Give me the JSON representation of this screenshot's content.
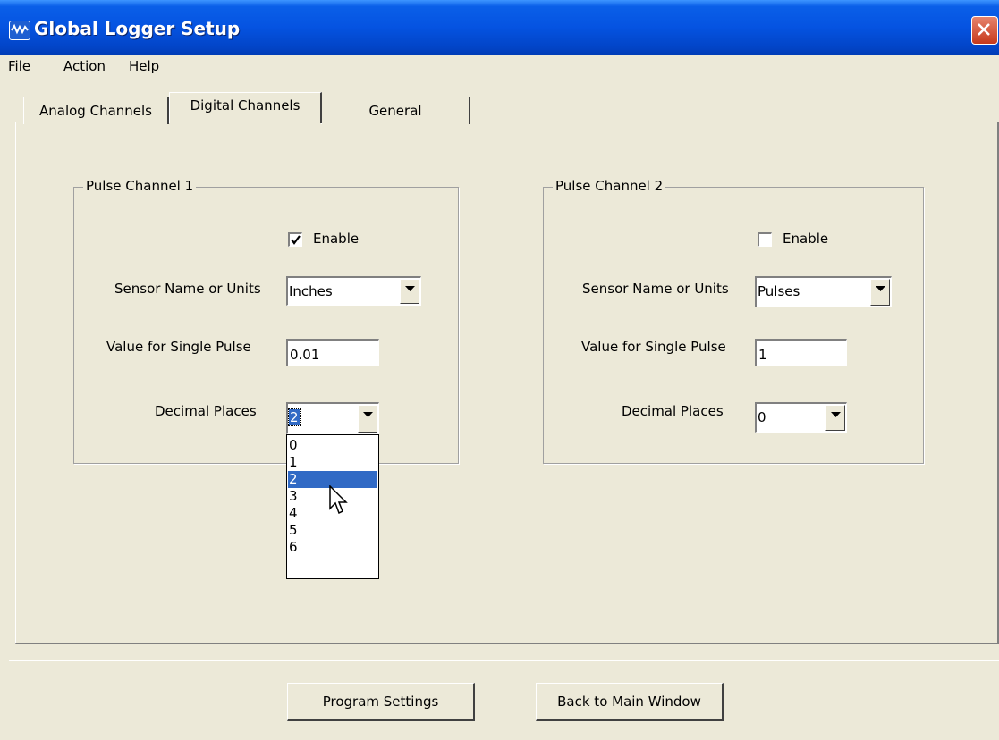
{
  "window": {
    "title": "Global Logger Setup"
  },
  "menu": [
    "File",
    "Action",
    "Help"
  ],
  "tabs": [
    {
      "label": "Analog Channels",
      "active": false
    },
    {
      "label": "Digital Channels",
      "active": true
    },
    {
      "label": "General",
      "active": false
    }
  ],
  "channels": [
    {
      "title": "Pulse Channel 1",
      "enable_label": "Enable",
      "enabled": true,
      "sensor_label": "Sensor Name or Units",
      "sensor_value": "Inches",
      "pulse_label": "Value for Single Pulse",
      "pulse_value": "0.01",
      "decimal_label": "Decimal Places",
      "decimal_value": "2"
    },
    {
      "title": "Pulse Channel 2",
      "enable_label": "Enable",
      "enabled": false,
      "sensor_label": "Sensor Name or Units",
      "sensor_value": "Pulses",
      "pulse_label": "Value for Single Pulse",
      "pulse_value": "1",
      "decimal_label": "Decimal Places",
      "decimal_value": "0"
    }
  ],
  "decimal_dropdown": {
    "options": [
      "0",
      "1",
      "2",
      "3",
      "4",
      "5",
      "6"
    ],
    "highlighted": "2"
  },
  "buttons": {
    "program_settings": "Program Settings",
    "back": "Back to Main Window"
  },
  "icons": {
    "app": "waveform-icon",
    "close": "close-icon",
    "check": "checkmark-icon",
    "dropdown": "triangle-down-icon",
    "cursor": "mouse-pointer-icon"
  },
  "colors": {
    "titlebar": "#0553e1",
    "selection": "#316ac5",
    "face": "#ece9d8",
    "close": "#c7391b"
  }
}
